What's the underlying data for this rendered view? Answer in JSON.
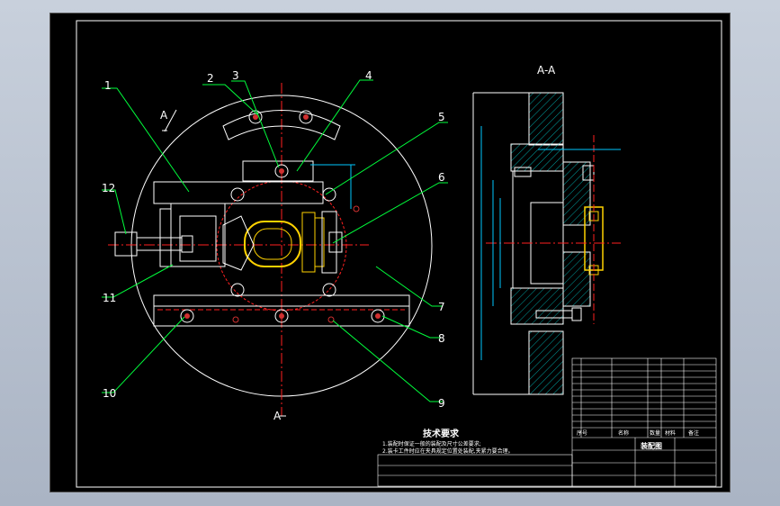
{
  "section_label": "A-A",
  "section_marks": [
    "A",
    "A"
  ],
  "balloons": [
    "1",
    "2",
    "3",
    "4",
    "5",
    "6",
    "7",
    "8",
    "9",
    "10",
    "11",
    "12"
  ],
  "tech_title": "技术要求",
  "tech_lines": [
    "1.装配时保证一般的装配及尺寸公差要求;",
    "2.装卡工件时应在夹具规定位置处装配,夹紧力要合理。"
  ],
  "title_block": {
    "drawing_title": "装配图",
    "headers": [
      "序号",
      "名称",
      "数量",
      "材料",
      "备注"
    ]
  },
  "colors": {
    "line": "#ffffff",
    "center": "#ff2020",
    "leader": "#00ff3c",
    "hatch": "#00a0a0",
    "part": "#ffd200",
    "dim": "#00c8ff"
  }
}
